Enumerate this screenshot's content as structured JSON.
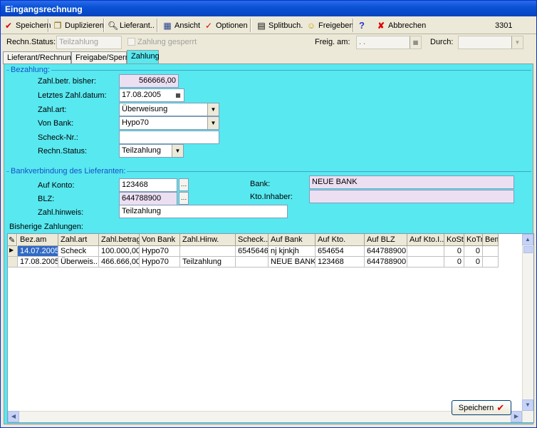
{
  "window": {
    "title": "Eingangsrechnung"
  },
  "toolbar": {
    "save": "Speichern",
    "duplicate": "Duplizieren",
    "supplier": "Lieferant..",
    "view": "Ansicht",
    "options": "Optionen",
    "split": "Splitbuch.",
    "release": "Freigeben",
    "help": "?",
    "cancel": "Abbrechen",
    "record_number": "3301"
  },
  "status_row": {
    "status_label": "Rechn.Status:",
    "status_value": "Teilzahlung",
    "paid_checkbox_label": "Zahlung gesperrt",
    "released_on_label": "Freig. am:",
    "released_on_value": "  .  .",
    "by_label": "Durch:",
    "by_value": ""
  },
  "tabs": [
    "Lieferant/Rechnung",
    "Freigabe/Sperre",
    "Zahlung"
  ],
  "payment": {
    "group_title": "Bezahlung:",
    "paid_so_far_label": "Zahl.betr. bisher:",
    "paid_so_far_value": "566666,00",
    "last_date_label": "Letztes Zahl.datum:",
    "last_date_value": "17.08.2005",
    "type_label": "Zahl.art:",
    "type_value": "Überweisung",
    "bank_label": "Von Bank:",
    "bank_value": "Hypo70",
    "check_label": "Scheck-Nr.:",
    "check_value": "",
    "status_label": "Rechn.Status:",
    "status_value": "Teilzahlung"
  },
  "supplier_bank": {
    "group_title": "Bankverbindung des Lieferanten:",
    "account_label": "Auf Konto:",
    "account_value": "123468",
    "blz_label": "BLZ:",
    "blz_value": "644788900",
    "note_label": "Zahl.hinweis:",
    "note_value": "Teilzahlung",
    "bank_label": "Bank:",
    "bank_value": "NEUE BANK",
    "holder_label": "Kto.Inhaber:",
    "holder_value": ""
  },
  "history": {
    "title": "Bisherige Zahlungen:",
    "columns": [
      "Bez.am",
      "Zahl.art",
      "Zahl.betrag",
      "Von Bank",
      "Zahl.Hinw.",
      "Scheck..",
      "Auf Bank",
      "Auf Kto.",
      "Auf BLZ",
      "Auf Kto.I..",
      "KoSt",
      "KoTr",
      "Bem."
    ],
    "rows": [
      [
        "14.07.2005",
        "Scheck",
        "100.000,00",
        "Hypo70",
        "",
        "6545646",
        "nj kjnkjh",
        "654654",
        "644788900",
        "",
        "0",
        "0",
        ""
      ],
      [
        "17.08.2005",
        "Überweis...",
        "466.666,00",
        "Hypo70",
        "Teilzahlung",
        "",
        "NEUE BANK",
        "123468",
        "644788900",
        "",
        "0",
        "0",
        ""
      ]
    ]
  },
  "footer": {
    "save": "Speichern"
  },
  "colors": {
    "panel": "#58e8f0",
    "title": "#0a52d6",
    "lavender": "#ecdff2"
  }
}
